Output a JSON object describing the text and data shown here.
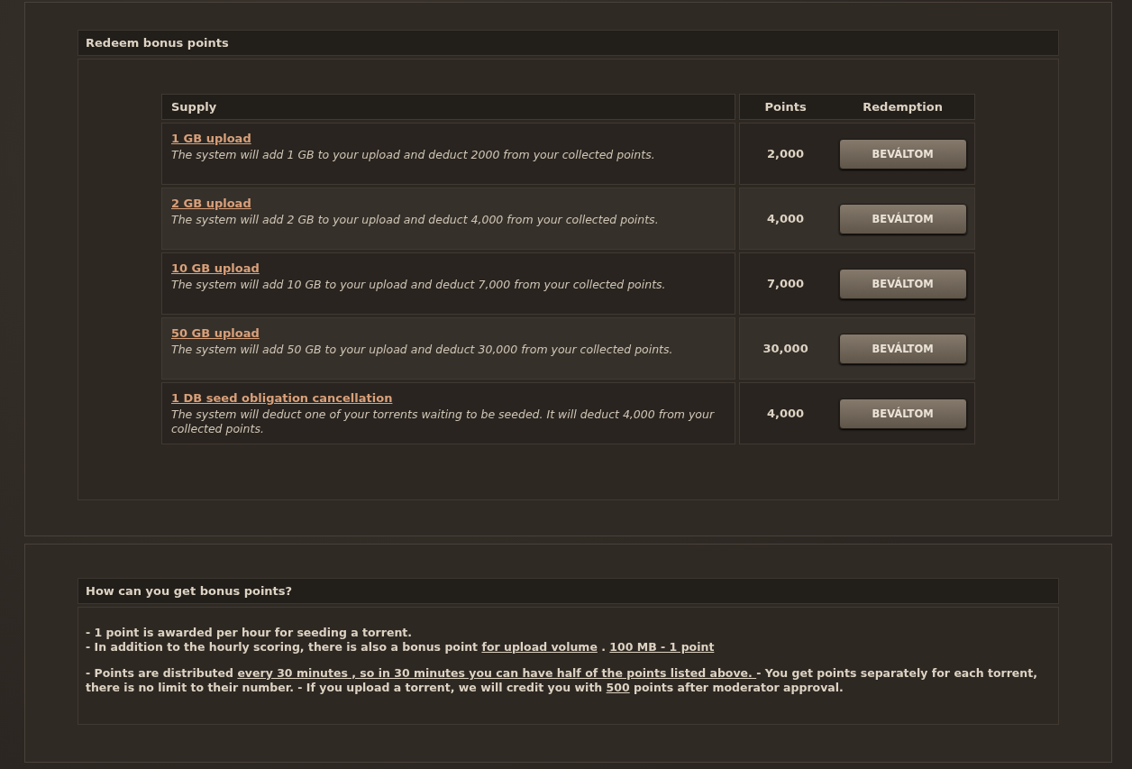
{
  "redeem": {
    "title": "Redeem bonus points",
    "columns": [
      "Supply",
      "Points",
      "Redemption"
    ],
    "rows": [
      {
        "name": "1 GB upload",
        "description": "The system will add 1 GB to your upload and deduct 2000 from your collected points.",
        "points": "2,000",
        "button": "BEVÁLTOM"
      },
      {
        "name": "2 GB upload",
        "description": "The system will add 2 GB to your upload and deduct 4,000 from your collected points.",
        "points": "4,000",
        "button": "BEVÁLTOM"
      },
      {
        "name": "10 GB upload",
        "description": "The system will add 10 GB to your upload and deduct 7,000 from your collected points.",
        "points": "7,000",
        "button": "BEVÁLTOM"
      },
      {
        "name": "50 GB upload",
        "description": "The system will add 50 GB to your upload and deduct 30,000 from your collected points.",
        "points": "30,000",
        "button": "BEVÁLTOM"
      },
      {
        "name": "1 DB seed obligation cancellation",
        "description": "The system will deduct one of your torrents waiting to be seeded. It will deduct 4,000 from your collected points.",
        "points": "4,000",
        "button": "BEVÁLTOM"
      }
    ]
  },
  "info": {
    "title": "How can you get bonus points?",
    "paragraphs": [
      [
        {
          "kind": "plain",
          "text": "- 1 point is awarded per hour for seeding a torrent."
        }
      ],
      [
        {
          "kind": "plain",
          "text": "- In addition to the hourly scoring, there is also a bonus point "
        },
        {
          "kind": "link",
          "text": "for upload volume"
        },
        {
          "kind": "plain",
          "text": " .   "
        },
        {
          "kind": "link",
          "text": "100 MB - 1 point"
        }
      ],
      [
        {
          "kind": "plain",
          "text": " - Points are distributed "
        },
        {
          "kind": "link",
          "text": "every 30 minutes , so in 30 minutes you can have half of the points listed above. "
        },
        {
          "kind": "plain",
          "text": " - You get points separately for each torrent, there is no limit to their number.  - If you upload a torrent, we will credit you with "
        },
        {
          "kind": "link",
          "text": "500"
        },
        {
          "kind": "plain",
          "text": " points after moderator approval."
        }
      ]
    ]
  }
}
